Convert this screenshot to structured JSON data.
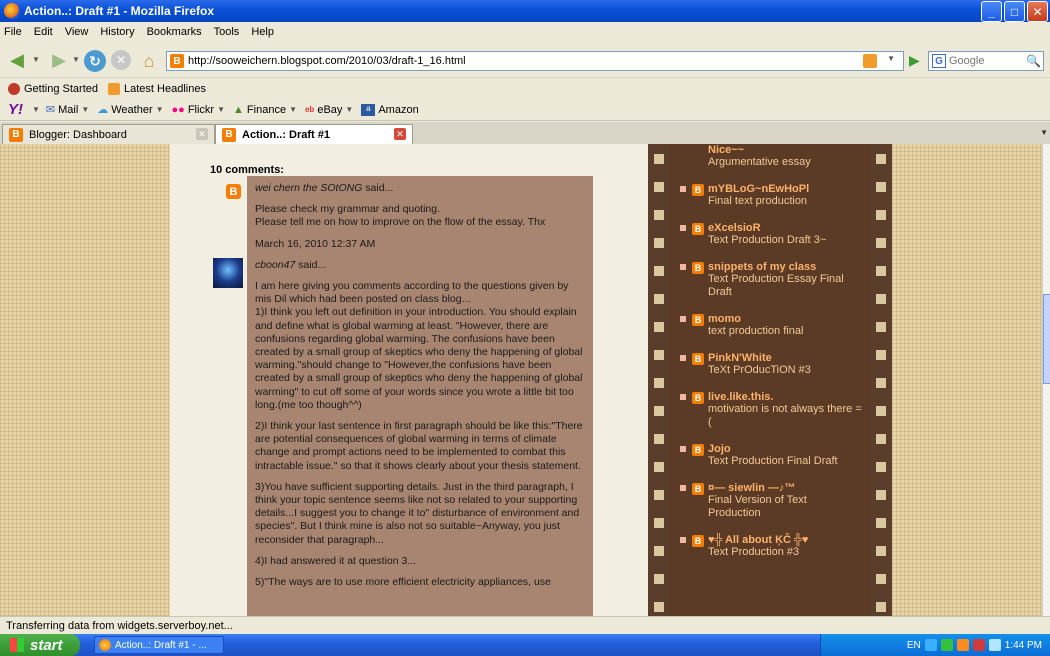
{
  "window": {
    "title": "Action..: Draft #1 - Mozilla Firefox"
  },
  "menu": {
    "items": [
      "File",
      "Edit",
      "View",
      "History",
      "Bookmarks",
      "Tools",
      "Help"
    ]
  },
  "nav": {
    "url": "http://sooweichern.blogspot.com/2010/03/draft-1_16.html",
    "search_placeholder": "Google"
  },
  "bookmarks": {
    "items": [
      "Getting Started",
      "Latest Headlines"
    ]
  },
  "yahoo_toolbar": {
    "items": [
      "Mail",
      "Weather",
      "Flickr",
      "Finance",
      "eBay",
      "Amazon"
    ]
  },
  "tabs": [
    {
      "label": "Blogger: Dashboard",
      "active": false
    },
    {
      "label": "Action..: Draft #1",
      "active": true
    }
  ],
  "comments": {
    "header": "10 comments:",
    "items": [
      {
        "author": "wei chern the SOtONG",
        "said": "said...",
        "paragraphs": [
          "Please check my grammar and quoting.\nPlease tell me on how to improve on the flow of the essay. Thx"
        ],
        "timestamp": "March 16, 2010 12:37 AM"
      },
      {
        "author": "cboon47",
        "said": "said...",
        "paragraphs": [
          "I am here giving you comments according to the questions given by mis Dil which had been posted on class blog...\n1)I think you left out definition in your introduction. You should explain and define what is global warming at least. \"However, there are confusions regarding global warming. The confusions have been created by a small group of skeptics who deny the happening of global warming.\"should change to \"However,the confusions have been created by a small group of skeptics who deny the happening of global warming\" to cut off some of your words since you wrote a little bit too long.(me too though^^)",
          "2)I think your last sentence in first paragraph should be like this:\"There are potential consequences of global warming in terms of climate change and prompt actions need to be implemented to combat this intractable issue.\" so that it shows clearly about your thesis statement.",
          "3)You have sufficient supporting details. Just in the third paragraph, I think your topic sentence seems like not so related to your supporting details...I suggest you to change it to\" disturbance of environment and species\". But I think mine is also not so suitable~Anyway, you just reconsider that paragraph...",
          "4)I had answered it at question 3...",
          "5)\"The ways are to use more efficient electricity appliances, use"
        ]
      }
    ]
  },
  "sidebar": {
    "top": {
      "link": "Nice~~",
      "sub": "Argumentative essay"
    },
    "items": [
      {
        "link": "mYBLoG~nEwHoPl",
        "sub": "Final text production"
      },
      {
        "link": "eXcelsioR",
        "sub": "Text Production Draft 3~"
      },
      {
        "link": "snippets of my class",
        "sub": "Text Production Essay Final Draft"
      },
      {
        "link": "momo",
        "sub": "text production final"
      },
      {
        "link": "PinkN'White",
        "sub": "TeXt PrOducTiON #3"
      },
      {
        "link": "live.like.this.",
        "sub": "motivation is not always there =("
      },
      {
        "link": "Jojo",
        "sub": "Text Production Final Draft"
      },
      {
        "link": "¤— siewlin —♪™",
        "sub": "Final Version of Text Production"
      },
      {
        "link": "♥╬ All about ĶĈ ╬♥",
        "sub": "Text Production #3"
      }
    ]
  },
  "status": {
    "text": "Transferring data from widgets.serverboy.net..."
  },
  "taskbar": {
    "start_label": "start",
    "task_label": "Action..: Draft #1 - ...",
    "lang": "EN",
    "clock": "1:44 PM"
  }
}
